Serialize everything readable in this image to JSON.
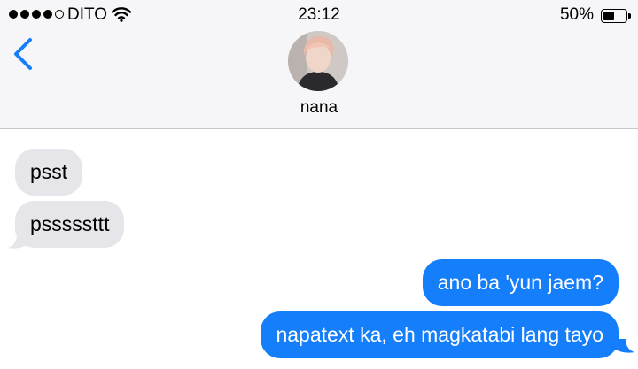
{
  "status_bar": {
    "carrier": "DITO",
    "time": "23:12",
    "battery_percent": "50%",
    "battery_level": 0.5,
    "signal_bars_filled": 4,
    "signal_bars_total": 5
  },
  "header": {
    "contact_name": "nana",
    "back_icon": "chevron-left-icon",
    "accent_color": "#147efb"
  },
  "messages": [
    {
      "direction": "incoming",
      "text": "psst"
    },
    {
      "direction": "incoming",
      "text": "psssssttt"
    },
    {
      "direction": "outgoing",
      "text": "ano ba 'yun jaem?"
    },
    {
      "direction": "outgoing",
      "text": "napatext ka, eh magkatabi lang tayo"
    }
  ],
  "colors": {
    "incoming_bubble": "#e5e5ea",
    "outgoing_bubble": "#147efb",
    "header_bg": "#f6f6f8"
  }
}
